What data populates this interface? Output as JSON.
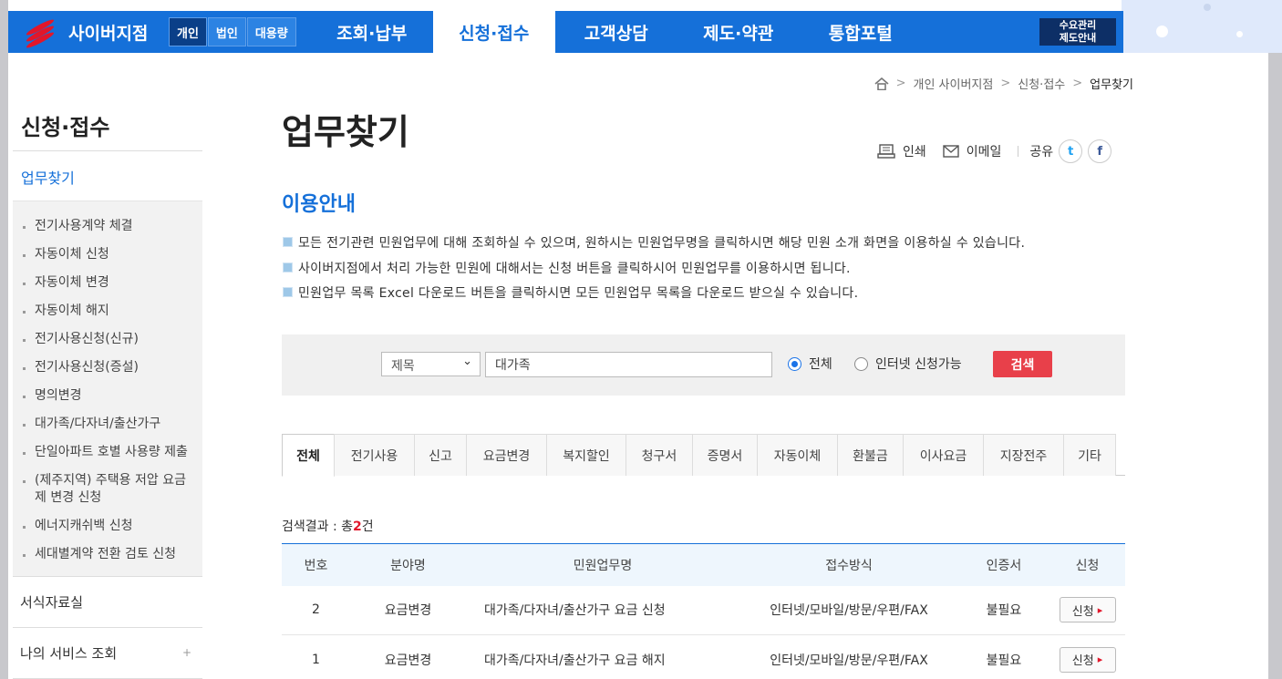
{
  "header": {
    "brand": "사이버지점",
    "segments": [
      "개인",
      "법인",
      "대용량"
    ],
    "menus": [
      "조회·납부",
      "신청·접수",
      "고객상담",
      "제도·약관",
      "통합포털"
    ],
    "demand_line1": "수요관리",
    "demand_line2": "제도안내"
  },
  "breadcrumb": [
    "개인 사이버지점",
    "신청·접수",
    "업무찾기"
  ],
  "sidebar": {
    "title": "신청·접수",
    "active": "업무찾기",
    "items": [
      "전기사용계약 체결",
      "자동이체 신청",
      "자동이체 변경",
      "자동이체 해지",
      "전기사용신청(신규)",
      "전기사용신청(증설)",
      "명의변경",
      "대가족/다자녀/출산가구",
      "단일아파트 호별 사용량 제출",
      "(제주지역) 주택용 저압 요금제 변경 신청",
      "에너지캐쉬백 신청",
      "세대별계약 전환 검토 신청"
    ],
    "forms": "서식자료실",
    "myservice": "나의 서비스 조회",
    "plus": "+"
  },
  "page": {
    "title": "업무찾기",
    "print": "인쇄",
    "email": "이메일",
    "share": "공유",
    "twitter": "t",
    "facebook": "f",
    "guide_title": "이용안내",
    "guide": [
      "모든 전기관련 민원업무에 대해 조회하실 수 있으며, 원하시는 민원업무명을 클릭하시면 해당 민원 소개 화면을 이용하실 수 있습니다.",
      "사이버지점에서 처리 가능한 민원에 대해서는 신청 버튼을 클릭하시어 민원업무를 이용하시면 됩니다.",
      "민원업무 목록 Excel 다운로드 버튼을 클릭하시면 모든 민원업무 목록을 다운로드 받으실 수 있습니다."
    ]
  },
  "search": {
    "select_value": "제목",
    "input_value": "대가족",
    "radio_all": "전체",
    "radio_online": "인터넷 신청가능",
    "button": "검색"
  },
  "tabs": [
    "전체",
    "전기사용",
    "신고",
    "요금변경",
    "복지할인",
    "청구서",
    "증명서",
    "자동이체",
    "환불금",
    "이사요금",
    "지장전주",
    "기타"
  ],
  "result": {
    "prefix": "검색결과 : 총",
    "count": "2",
    "suffix": "건"
  },
  "table": {
    "headers": [
      "번호",
      "분야명",
      "민원업무명",
      "접수방식",
      "인증서",
      "신청"
    ],
    "rows": [
      {
        "no": "2",
        "field": "요금변경",
        "name": "대가족/다자녀/출산가구 요금 신청",
        "method": "인터넷/모바일/방문/우편/FAX",
        "cert": "불필요",
        "apply": "신청"
      },
      {
        "no": "1",
        "field": "요금변경",
        "name": "대가족/다자녀/출산가구 요금 해지",
        "method": "인터넷/모바일/방문/우편/FAX",
        "cert": "불필요",
        "apply": "신청"
      }
    ]
  },
  "colors": {
    "primary": "#1570d9",
    "accent": "#e2162a",
    "search_button": "#e8404a"
  }
}
